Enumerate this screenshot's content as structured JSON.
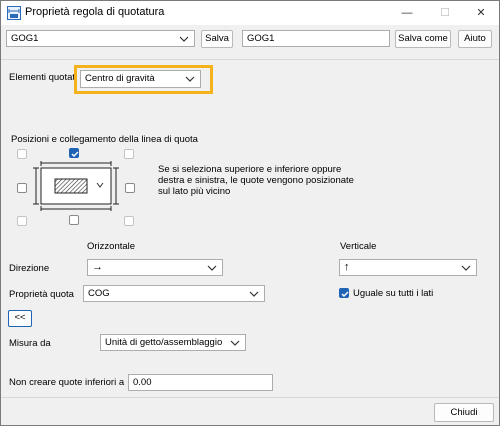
{
  "window": {
    "title": "Proprietà regola di quotatura",
    "controls": {
      "minimize": "—",
      "maximize": "☐",
      "close": "✕"
    }
  },
  "toolbar": {
    "preset_value": "GOG1",
    "save_label": "Salva",
    "save_as_name": "GOG1",
    "save_as_label": "Salva come",
    "help_label": "Aiuto"
  },
  "elements": {
    "label": "Elementi quotati",
    "value": "Centro di gravità"
  },
  "positions": {
    "heading": "Posizioni e collegamento della linea di quota",
    "help_text": [
      "Se si seleziona superiore e inferiore oppure",
      "destra e sinistra, le quote vengono posizionate",
      "sul lato più vicino"
    ],
    "checkboxes": {
      "top_left": false,
      "top": true,
      "top_right": false,
      "left": false,
      "right": false,
      "bottom_left": false,
      "bottom": false,
      "bottom_right": false
    }
  },
  "direction": {
    "horizontal_heading": "Orizzontale",
    "vertical_heading": "Verticale",
    "label": "Direzione",
    "horizontal_value": "→",
    "vertical_value": "↑"
  },
  "dimension_property": {
    "label": "Proprietà quota",
    "value": "COG",
    "same_all_sides_label": "Uguale su tutti i lati",
    "same_all_sides_checked": true
  },
  "collapse_button": "<<",
  "measure_from": {
    "label": "Misura da",
    "value": "Unità di getto/assemblaggio"
  },
  "min_dimension": {
    "label": "Non creare quote inferiori a",
    "value": "0.00"
  },
  "close_button": "Chiudi",
  "colors": {
    "accent": "#1f63b5",
    "highlight": "#f4b21c"
  }
}
